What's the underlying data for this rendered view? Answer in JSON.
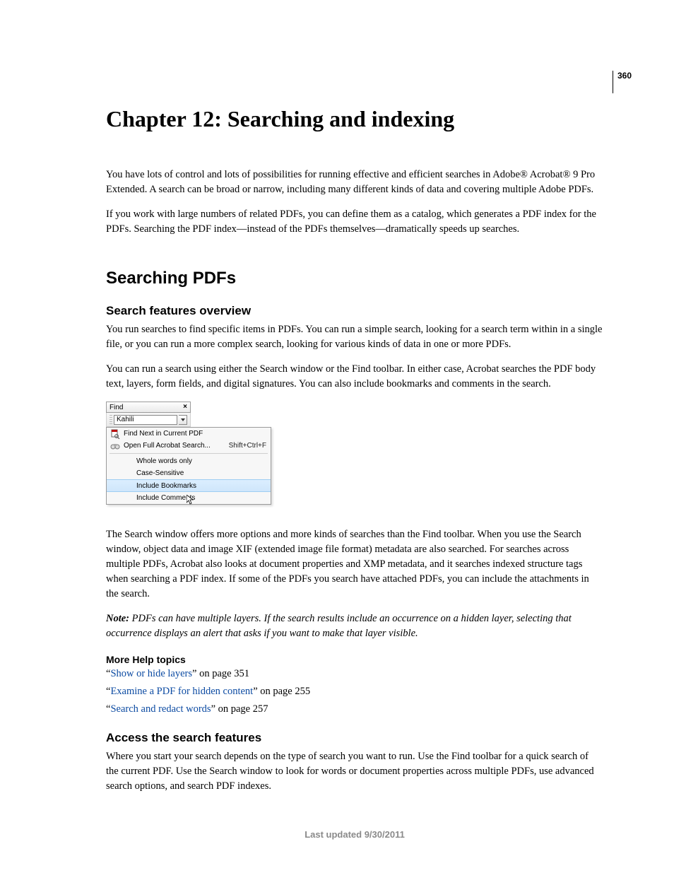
{
  "page_number": "360",
  "chapter_title": "Chapter 12: Searching and indexing",
  "intro_p1": "You have lots of control and lots of possibilities for running effective and efficient searches in Adobe® Acrobat® 9 Pro Extended. A search can be broad or narrow, including many different kinds of data and covering multiple Adobe PDFs.",
  "intro_p2": "If you work with large numbers of related PDFs, you can define them as a catalog, which generates a PDF index for the PDFs. Searching the PDF index—instead of the PDFs themselves—dramatically speeds up searches.",
  "section1_title": "Searching PDFs",
  "sub1_title": "Search features overview",
  "sub1_p1": "You run searches to find specific items in PDFs. You can run a simple search, looking for a search term within in a single file, or you can run a more complex search, looking for various kinds of data in one or more PDFs.",
  "sub1_p2": "You can run a search using either the Search window or the Find toolbar. In either case, Acrobat searches the PDF body text, layers, form fields, and digital signatures. You can also include bookmarks and comments in the search.",
  "find_fig": {
    "title": "Find",
    "close": "×",
    "input_value": "Kahili",
    "menu": {
      "find_next": "Find Next in Current PDF",
      "open_full": "Open Full Acrobat Search...",
      "open_full_accel": "Shift+Ctrl+F",
      "whole_words": "Whole words only",
      "case_sensitive": "Case-Sensitive",
      "include_bookmarks": "Include Bookmarks",
      "include_comments": "Include Comments"
    }
  },
  "sub1_p3": "The Search window offers more options and more kinds of searches than the Find toolbar. When you use the Search window, object data and image XIF (extended image file format) metadata are also searched. For searches across multiple PDFs, Acrobat also looks at document properties and XMP metadata, and it searches indexed structure tags when searching a PDF index. If some of the PDFs you search have attached PDFs, you can include the attachments in the search.",
  "note_label": "Note:",
  "note_body": " PDFs can have multiple layers. If the search results include an occurrence on a hidden layer, selecting that occurrence displays an alert that asks if you want to make that layer visible.",
  "morehelp_title": "More Help topics",
  "help_links": [
    {
      "q1": "“",
      "link": "Show or hide layers",
      "rest": "” on page 351"
    },
    {
      "q1": "“",
      "link": "Examine a PDF for hidden content",
      "rest": "” on page 255"
    },
    {
      "q1": "“",
      "link": "Search and redact words",
      "rest": "” on page 257"
    }
  ],
  "sub2_title": "Access the search features",
  "sub2_p1": "Where you start your search depends on the type of search you want to run. Use the Find toolbar for a quick search of the current PDF. Use the Search window to look for words or document properties across multiple PDFs, use advanced search options, and search PDF indexes.",
  "footer": "Last updated 9/30/2011"
}
